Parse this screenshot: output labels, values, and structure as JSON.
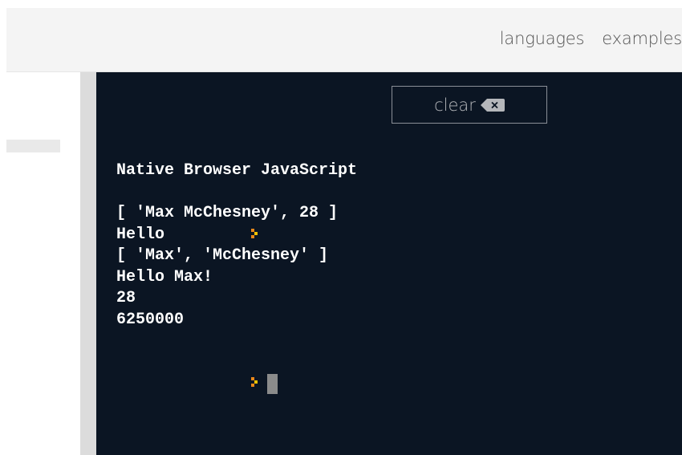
{
  "nav": {
    "languages": "languages",
    "examples": "examples"
  },
  "console": {
    "clear_label": "clear",
    "header": "Native Browser JavaScript",
    "output_lines": [
      "[ 'Max McChesney', 28 ]",
      "Hello",
      "[ 'Max', 'McChesney' ]",
      "Hello Max!",
      "28",
      "6250000"
    ],
    "colors": {
      "background": "#0b1523",
      "text": "#ffffff",
      "prompt_orange": "#e8871a",
      "prompt_yellow": "#f2c200"
    }
  }
}
